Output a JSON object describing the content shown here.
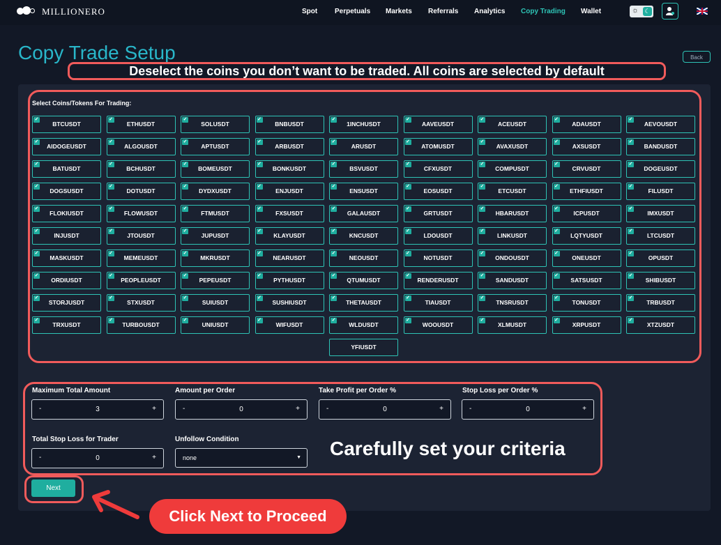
{
  "app": {
    "name": "MILLIONERO"
  },
  "nav": {
    "items": [
      "Spot",
      "Perpetuals",
      "Markets",
      "Referrals",
      "Analytics",
      "Copy Trading",
      "Wallet"
    ],
    "active": "Copy Trading"
  },
  "page": {
    "title": "Copy Trade Setup",
    "back_label": "Back"
  },
  "annotations": {
    "banner": "Deselect the coins you don’t want to be traded. All coins are selected by default",
    "criteria": "Carefully set your criteria",
    "cta": "Click Next to Proceed"
  },
  "coins": {
    "label": "Select Coins/Tokens For Trading:",
    "items": [
      "BTCUSDT",
      "ETHUSDT",
      "SOLUSDT",
      "BNBUSDT",
      "1INCHUSDT",
      "AAVEUSDT",
      "ACEUSDT",
      "ADAUSDT",
      "AEVOUSDT",
      "AIDOGEUSDT",
      "ALGOUSDT",
      "APTUSDT",
      "ARBUSDT",
      "ARUSDT",
      "ATOMUSDT",
      "AVAXUSDT",
      "AXSUSDT",
      "BANDUSDT",
      "BATUSDT",
      "BCHUSDT",
      "BOMEUSDT",
      "BONKUSDT",
      "BSVUSDT",
      "CFXUSDT",
      "COMPUSDT",
      "CRVUSDT",
      "DOGEUSDT",
      "DOGSUSDT",
      "DOTUSDT",
      "DYDXUSDT",
      "ENJUSDT",
      "ENSUSDT",
      "EOSUSDT",
      "ETCUSDT",
      "ETHFIUSDT",
      "FILUSDT",
      "FLOKIUSDT",
      "FLOWUSDT",
      "FTMUSDT",
      "FXSUSDT",
      "GALAUSDT",
      "GRTUSDT",
      "HBARUSDT",
      "ICPUSDT",
      "IMXUSDT",
      "INJUSDT",
      "JTOUSDT",
      "JUPUSDT",
      "KLAYUSDT",
      "KNCUSDT",
      "LDOUSDT",
      "LINKUSDT",
      "LQTYUSDT",
      "LTCUSDT",
      "MASKUSDT",
      "MEMEUSDT",
      "MKRUSDT",
      "NEARUSDT",
      "NEOUSDT",
      "NOTUSDT",
      "ONDOUSDT",
      "ONEUSDT",
      "OPUSDT",
      "ORDIUSDT",
      "PEOPLEUSDT",
      "PEPEUSDT",
      "PYTHUSDT",
      "QTUMUSDT",
      "RENDERUSDT",
      "SANDUSDT",
      "SATSUSDT",
      "SHIBUSDT",
      "STORJUSDT",
      "STXUSDT",
      "SUIUSDT",
      "SUSHIUSDT",
      "THETAUSDT",
      "TIAUSDT",
      "TNSRUSDT",
      "TONUSDT",
      "TRBUSDT",
      "TRXUSDT",
      "TURBOUSDT",
      "UNIUSDT",
      "WIFUSDT",
      "WLDUSDT",
      "WOOUSDT",
      "XLMUSDT",
      "XRPUSDT",
      "XTZUSDT",
      "YFIUSDT"
    ],
    "unchecked": [
      "YFIUSDT"
    ]
  },
  "criteria": {
    "max_total": {
      "label": "Maximum Total Amount",
      "value": "3"
    },
    "per_order": {
      "label": "Amount per Order",
      "value": "0"
    },
    "take_profit": {
      "label": "Take Profit per Order %",
      "value": "0"
    },
    "stop_loss": {
      "label": "Stop Loss per Order %",
      "value": "0"
    },
    "total_stop_loss": {
      "label": "Total Stop Loss for Trader",
      "value": "0"
    },
    "unfollow": {
      "label": "Unfollow Condition",
      "value": "none"
    },
    "minus": "-",
    "plus": "+"
  },
  "actions": {
    "next_label": "Next"
  },
  "colors": {
    "accent": "#2ec4b6",
    "annotation": "#f15b5b",
    "cta": "#ef3b3b",
    "title": "#29b6c9"
  }
}
